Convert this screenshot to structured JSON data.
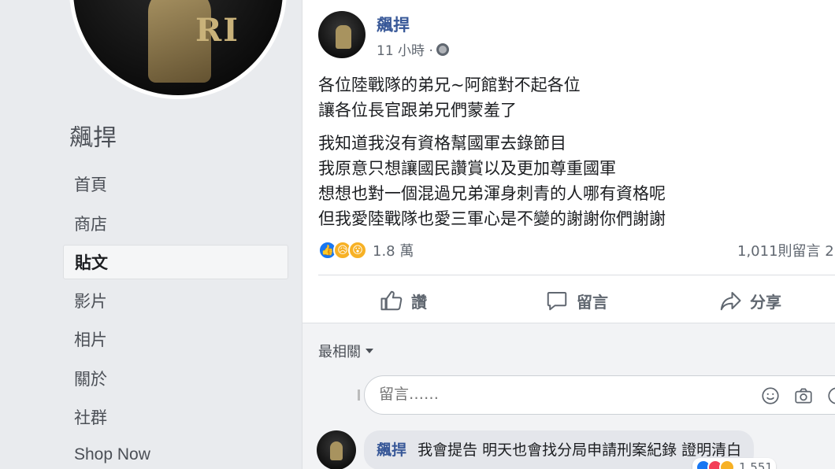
{
  "page": {
    "name": "飆捍"
  },
  "sidebar": {
    "items": [
      {
        "label": "首頁"
      },
      {
        "label": "商店"
      },
      {
        "label": "貼文",
        "active": true
      },
      {
        "label": "影片"
      },
      {
        "label": "相片"
      },
      {
        "label": "關於"
      },
      {
        "label": "社群"
      },
      {
        "label": "Shop Now"
      }
    ]
  },
  "post": {
    "author": "飆捍",
    "time": "11 小時 ·",
    "paragraph1": [
      "各位陸戰隊的弟兄~阿館對不起各位",
      "讓各位長官跟弟兄們蒙羞了"
    ],
    "paragraph2": [
      "我知道我沒有資格幫國軍去錄節目",
      "我原意只想讓國民讚賞以及更加尊重國軍",
      "想想也對一個混過兄弟渾身刺青的人哪有資格呢",
      "但我愛陸戰隊也愛三軍心是不變的謝謝你們謝謝"
    ],
    "reaction_count": "1.8 萬",
    "comment_count": "1,011則留言 2",
    "actions": {
      "like": "讚",
      "comment": "留言",
      "share": "分享"
    }
  },
  "comments": {
    "sort_label": "最相關",
    "composer_placeholder": "留言……",
    "items": [
      {
        "author": "飆捍",
        "text": "我會提告 明天也會找分局申請刑案紀錄 證明清白",
        "reactions": "1,551"
      }
    ]
  },
  "colors": {
    "link": "#385898",
    "like": "#1877f2",
    "background": "#e9ebee"
  }
}
